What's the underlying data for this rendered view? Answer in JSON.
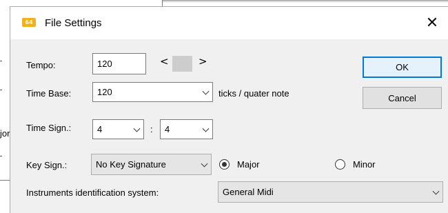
{
  "background": {
    "partial_text": "jor"
  },
  "dialog": {
    "title": "File Settings",
    "icon_text": "64",
    "close_symbol": "✕"
  },
  "tempo": {
    "label": "Tempo:",
    "value": "120",
    "left_arrow": "<",
    "right_arrow": ">"
  },
  "time_base": {
    "label": "Time Base:",
    "value": "120",
    "unit": "ticks / quater note"
  },
  "time_sign": {
    "label": "Time Sign.:",
    "numerator": "4",
    "separator": ":",
    "denominator": "4"
  },
  "key_sign": {
    "label": "Key Sign.:",
    "value": "No Key Signature",
    "major_label": "Major",
    "minor_label": "Minor",
    "selected": "Major"
  },
  "instruments": {
    "label": "Instruments identification system:",
    "value": "General Midi"
  },
  "buttons": {
    "ok": "OK",
    "cancel": "Cancel"
  },
  "colors": {
    "accent": "#0078d7",
    "icon": "#f2b01e",
    "dialog_bg": "#f0f0f0"
  }
}
